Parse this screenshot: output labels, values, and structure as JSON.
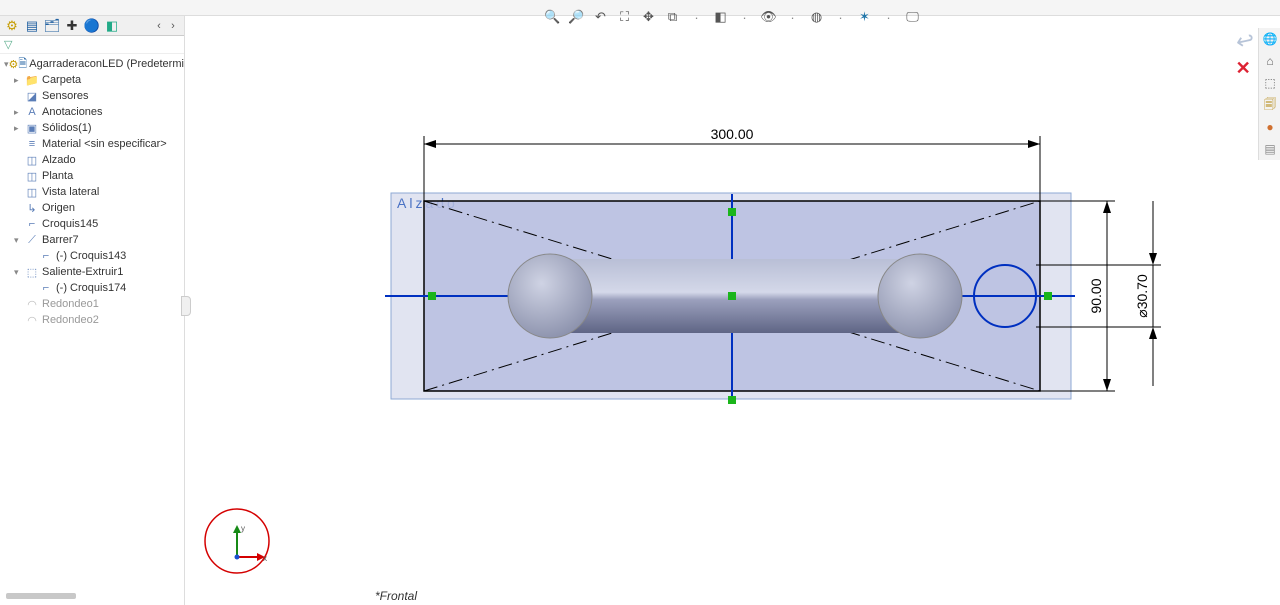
{
  "tabs": {
    "icons": [
      "feature-manager",
      "property-manager",
      "config-manager",
      "dimxpert",
      "display-manager",
      "appearance-manager"
    ],
    "nav_prev": "‹",
    "nav_next": "›"
  },
  "filter_icon": "▽",
  "tree": {
    "root": "AgarraderaconLED (Predeterminado",
    "items": [
      {
        "label": "Carpeta",
        "indent": 1,
        "icon": "📁",
        "exp": "▸"
      },
      {
        "label": "Sensores",
        "indent": 1,
        "icon": "◪"
      },
      {
        "label": "Anotaciones",
        "indent": 1,
        "icon": "A",
        "exp": "▸"
      },
      {
        "label": "Sólidos(1)",
        "indent": 1,
        "icon": "▣",
        "exp": "▸"
      },
      {
        "label": "Material <sin especificar>",
        "indent": 1,
        "icon": "≡"
      },
      {
        "label": "Alzado",
        "indent": 1,
        "icon": "◫"
      },
      {
        "label": "Planta",
        "indent": 1,
        "icon": "◫"
      },
      {
        "label": "Vista lateral",
        "indent": 1,
        "icon": "◫"
      },
      {
        "label": "Origen",
        "indent": 1,
        "icon": "↳"
      },
      {
        "label": "Croquis145",
        "indent": 1,
        "icon": "⌐"
      },
      {
        "label": "Barrer7",
        "indent": 1,
        "icon": "⟋",
        "exp": "▾"
      },
      {
        "label": "(-) Croquis143",
        "indent": 2,
        "icon": "⌐"
      },
      {
        "label": "Saliente-Extruir1",
        "indent": 1,
        "icon": "⬚",
        "exp": "▾"
      },
      {
        "label": "(-) Croquis174",
        "indent": 2,
        "icon": "⌐"
      },
      {
        "label": "Redondeo1",
        "indent": 1,
        "icon": "◠",
        "grey": true
      },
      {
        "label": "Redondeo2",
        "indent": 1,
        "icon": "◠",
        "grey": true
      }
    ]
  },
  "view_toolbar": {
    "icons": [
      {
        "name": "zoom-fit-icon",
        "glyph": "🔍"
      },
      {
        "name": "zoom-area-icon",
        "glyph": "🔎"
      },
      {
        "name": "previous-view-icon",
        "glyph": "↶"
      },
      {
        "name": "section-view-icon",
        "glyph": "⛶"
      },
      {
        "name": "dynamic-zoom-icon",
        "glyph": "✥"
      },
      {
        "name": "view-orientation-icon",
        "glyph": "⧉"
      },
      {
        "name": "display-style-icon",
        "glyph": "◧"
      },
      {
        "name": "hide-show-icon",
        "glyph": "👁"
      },
      {
        "name": "edit-appearance-icon",
        "glyph": "◍"
      },
      {
        "name": "apply-scene-icon",
        "glyph": "✶"
      },
      {
        "name": "view-settings-icon",
        "glyph": "🖵"
      }
    ]
  },
  "right_toolbar": [
    {
      "name": "world-icon",
      "glyph": "🌐",
      "color": "#1a73d1"
    },
    {
      "name": "home-icon",
      "glyph": "⌂",
      "color": "#666"
    },
    {
      "name": "box-icon",
      "glyph": "⬚",
      "color": "#666"
    },
    {
      "name": "clipboard-icon",
      "glyph": "🗐",
      "color": "#b08000"
    },
    {
      "name": "sphere-icon",
      "glyph": "●",
      "color": "#b22"
    },
    {
      "name": "panel-icon",
      "glyph": "▤",
      "color": "#888"
    }
  ],
  "exit": {
    "accept": "✓",
    "cancel": "✕"
  },
  "canvas": {
    "plane_label": "Alzado",
    "dim_width": "300.00",
    "dim_height": "90.00",
    "dim_dia": "⌀30.70"
  },
  "triad": {
    "x": "x",
    "y": "y"
  },
  "status_text": "*Frontal"
}
